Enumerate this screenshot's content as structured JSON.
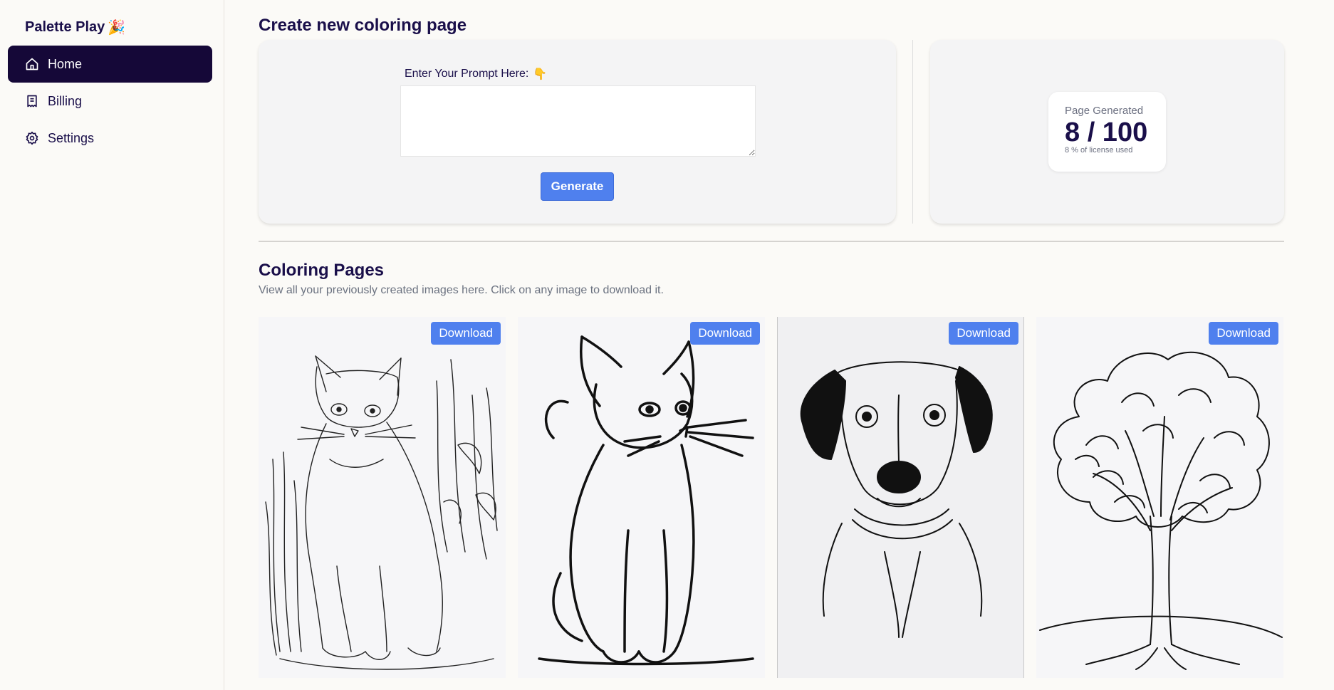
{
  "app": {
    "brand": "Palette Play",
    "brand_emoji": "🎉"
  },
  "sidebar": {
    "items": [
      {
        "label": "Home",
        "icon": "home-icon",
        "active": true
      },
      {
        "label": "Billing",
        "icon": "receipt-icon",
        "active": false
      },
      {
        "label": "Settings",
        "icon": "gear-icon",
        "active": false
      }
    ]
  },
  "create": {
    "title": "Create new coloring page",
    "prompt_label": "Enter Your Prompt Here:",
    "prompt_emoji": "👇",
    "prompt_value": "",
    "generate_label": "Generate"
  },
  "stats": {
    "label": "Page Generated",
    "value": "8 / 100",
    "sub": "8 % of license used"
  },
  "gallery": {
    "title": "Coloring Pages",
    "description": "View all your previously created images here. Click on any image to download it.",
    "download_label": "Download",
    "items": [
      {
        "subject": "cat-sitting-in-grass"
      },
      {
        "subject": "cat-bold-outline"
      },
      {
        "subject": "dog-portrait"
      },
      {
        "subject": "tree"
      }
    ]
  },
  "colors": {
    "accent": "#4f80ee",
    "nav_active": "#150838",
    "text_primary": "#1a0f4a"
  }
}
